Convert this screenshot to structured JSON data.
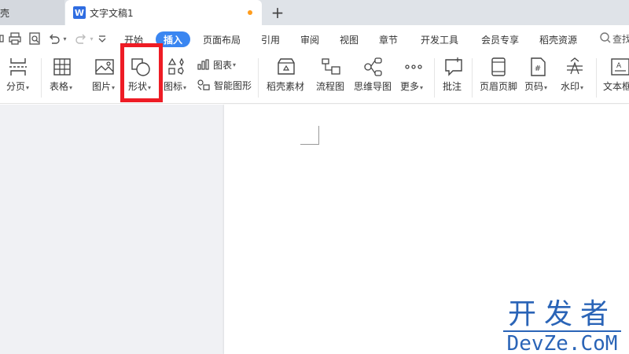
{
  "tabs": {
    "prev_label": "壳",
    "active_icon": "W",
    "active_label": "文字文稿1",
    "new_tab": "+"
  },
  "menu": {
    "items": [
      "开始",
      "插入",
      "页面布局",
      "引用",
      "审阅",
      "视图",
      "章节",
      "开发工具",
      "会员专享",
      "稻壳资源"
    ],
    "active": "插入",
    "search_label": "查找"
  },
  "ribbon": {
    "page_break": "分页",
    "table": "表格",
    "picture": "图片",
    "shape": "形状",
    "icon": "图标",
    "chart": "图表",
    "smart_art": "智能图形",
    "docer_material": "稻壳素材",
    "flowchart": "流程图",
    "mindmap": "思维导图",
    "more": "更多",
    "comment": "批注",
    "header_footer": "页眉页脚",
    "page_number": "页码",
    "watermark": "水印",
    "textbox": "文本框"
  },
  "watermark_overlay": {
    "cn": "开发者",
    "en": "DevZe.CoM"
  },
  "colors": {
    "accent": "#3a86f1",
    "highlight": "#ee1c25",
    "unsaved_dot": "#ff9c1c",
    "watermark": "#2a64b7"
  }
}
